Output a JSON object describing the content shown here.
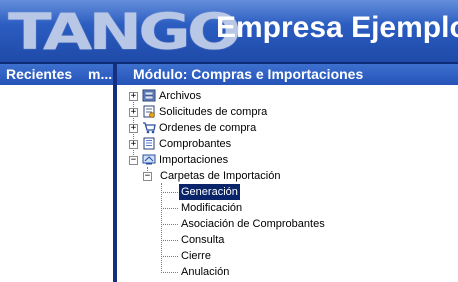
{
  "header": {
    "logo_text": "TANGO",
    "company_name": "Empresa Ejemplo"
  },
  "left_panel": {
    "title": "Recientes",
    "tab_label": "m..."
  },
  "right_panel": {
    "title": "Módulo: Compras e Importaciones"
  },
  "tree": {
    "items": [
      {
        "label": "Archivos",
        "icon": "cabinet-icon",
        "expander": "+"
      },
      {
        "label": "Solicitudes de compra",
        "icon": "request-icon",
        "expander": "+"
      },
      {
        "label": "Ordenes de compra",
        "icon": "cart-icon",
        "expander": "+"
      },
      {
        "label": "Comprobantes",
        "icon": "document-icon",
        "expander": "+"
      },
      {
        "label": "Importaciones",
        "icon": "ship-icon",
        "expander": "−"
      }
    ],
    "folder": {
      "label": "Carpetas de Importación",
      "expander": "−"
    },
    "leaves": [
      {
        "label": "Generación",
        "selected": true
      },
      {
        "label": "Modificación"
      },
      {
        "label": "Asociación de Comprobantes"
      },
      {
        "label": "Consulta"
      },
      {
        "label": "Cierre"
      },
      {
        "label": "Anulación"
      }
    ]
  },
  "colors": {
    "banner_blue": "#2a5bbf",
    "selection": "#0a246a"
  }
}
